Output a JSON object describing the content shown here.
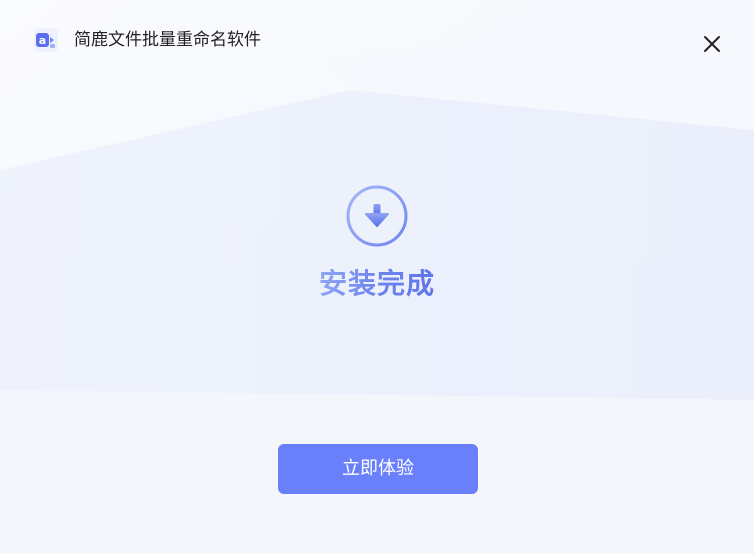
{
  "window": {
    "title": "简鹿文件批量重命名软件"
  },
  "install": {
    "status": "安装完成",
    "action_label": "立即体验"
  },
  "icons": {
    "app_logo": "app-logo-icon",
    "close": "close-icon",
    "status": "download-arrow-circle-icon"
  },
  "colors": {
    "accent": "#6a80fb",
    "button_text": "#ffffff",
    "title_text": "#222222"
  }
}
